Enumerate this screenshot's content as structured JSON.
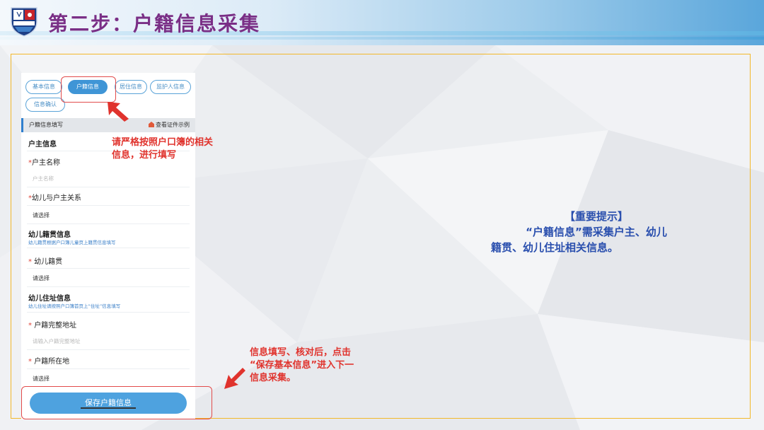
{
  "slide": {
    "title": "第二步：户籍信息采集"
  },
  "tabs": [
    {
      "label": "基本信息",
      "active": false
    },
    {
      "label": "户籍信息",
      "active": true
    },
    {
      "label": "居住信息",
      "active": false
    },
    {
      "label": "监护人信息",
      "active": false
    },
    {
      "label": "信息确认",
      "active": false
    }
  ],
  "section": {
    "title": "户籍信息填写",
    "example_link": "查看证件示例"
  },
  "form": {
    "householder_heading": "户主信息",
    "householder_name_label": "户主名称",
    "householder_name_placeholder": "户主名称",
    "relation_label": "幼儿与户主关系",
    "relation_value": "请选择",
    "native_heading": "幼儿籍贯信息",
    "native_hint": "幼儿籍贯根据户口簿儿童页上籍贯信息填写",
    "native_label": "幼儿籍贯",
    "native_value": "请选择",
    "address_heading": "幼儿住址信息",
    "address_hint": "幼儿住址请按照户口簿首页上“住址”信息填写",
    "full_address_label": "户籍完整地址",
    "full_address_placeholder": "请输入户籍完整地址",
    "location_label": "户籍所在地",
    "location_value": "请选择",
    "save_button": "保存户籍信息"
  },
  "annotations": {
    "strict_note_1": "请严格按照户口簿的相关",
    "strict_note_2": "信息，进行填写",
    "save_note_1": "信息填写、核对后，点击",
    "save_note_2": "“保存基本信息”进入下一",
    "save_note_3": "信息采集。",
    "tip_title": "【重要提示】",
    "tip_line1": "“户籍信息”需采集户主、幼儿",
    "tip_line2": "籍贯、幼儿住址相关信息。"
  },
  "colors": {
    "accent_blue": "#3f95d6",
    "title_purple": "#7a2f86",
    "note_red": "#e0332d",
    "tip_blue": "#2a4fae",
    "frame_orange": "#f2b82a"
  }
}
